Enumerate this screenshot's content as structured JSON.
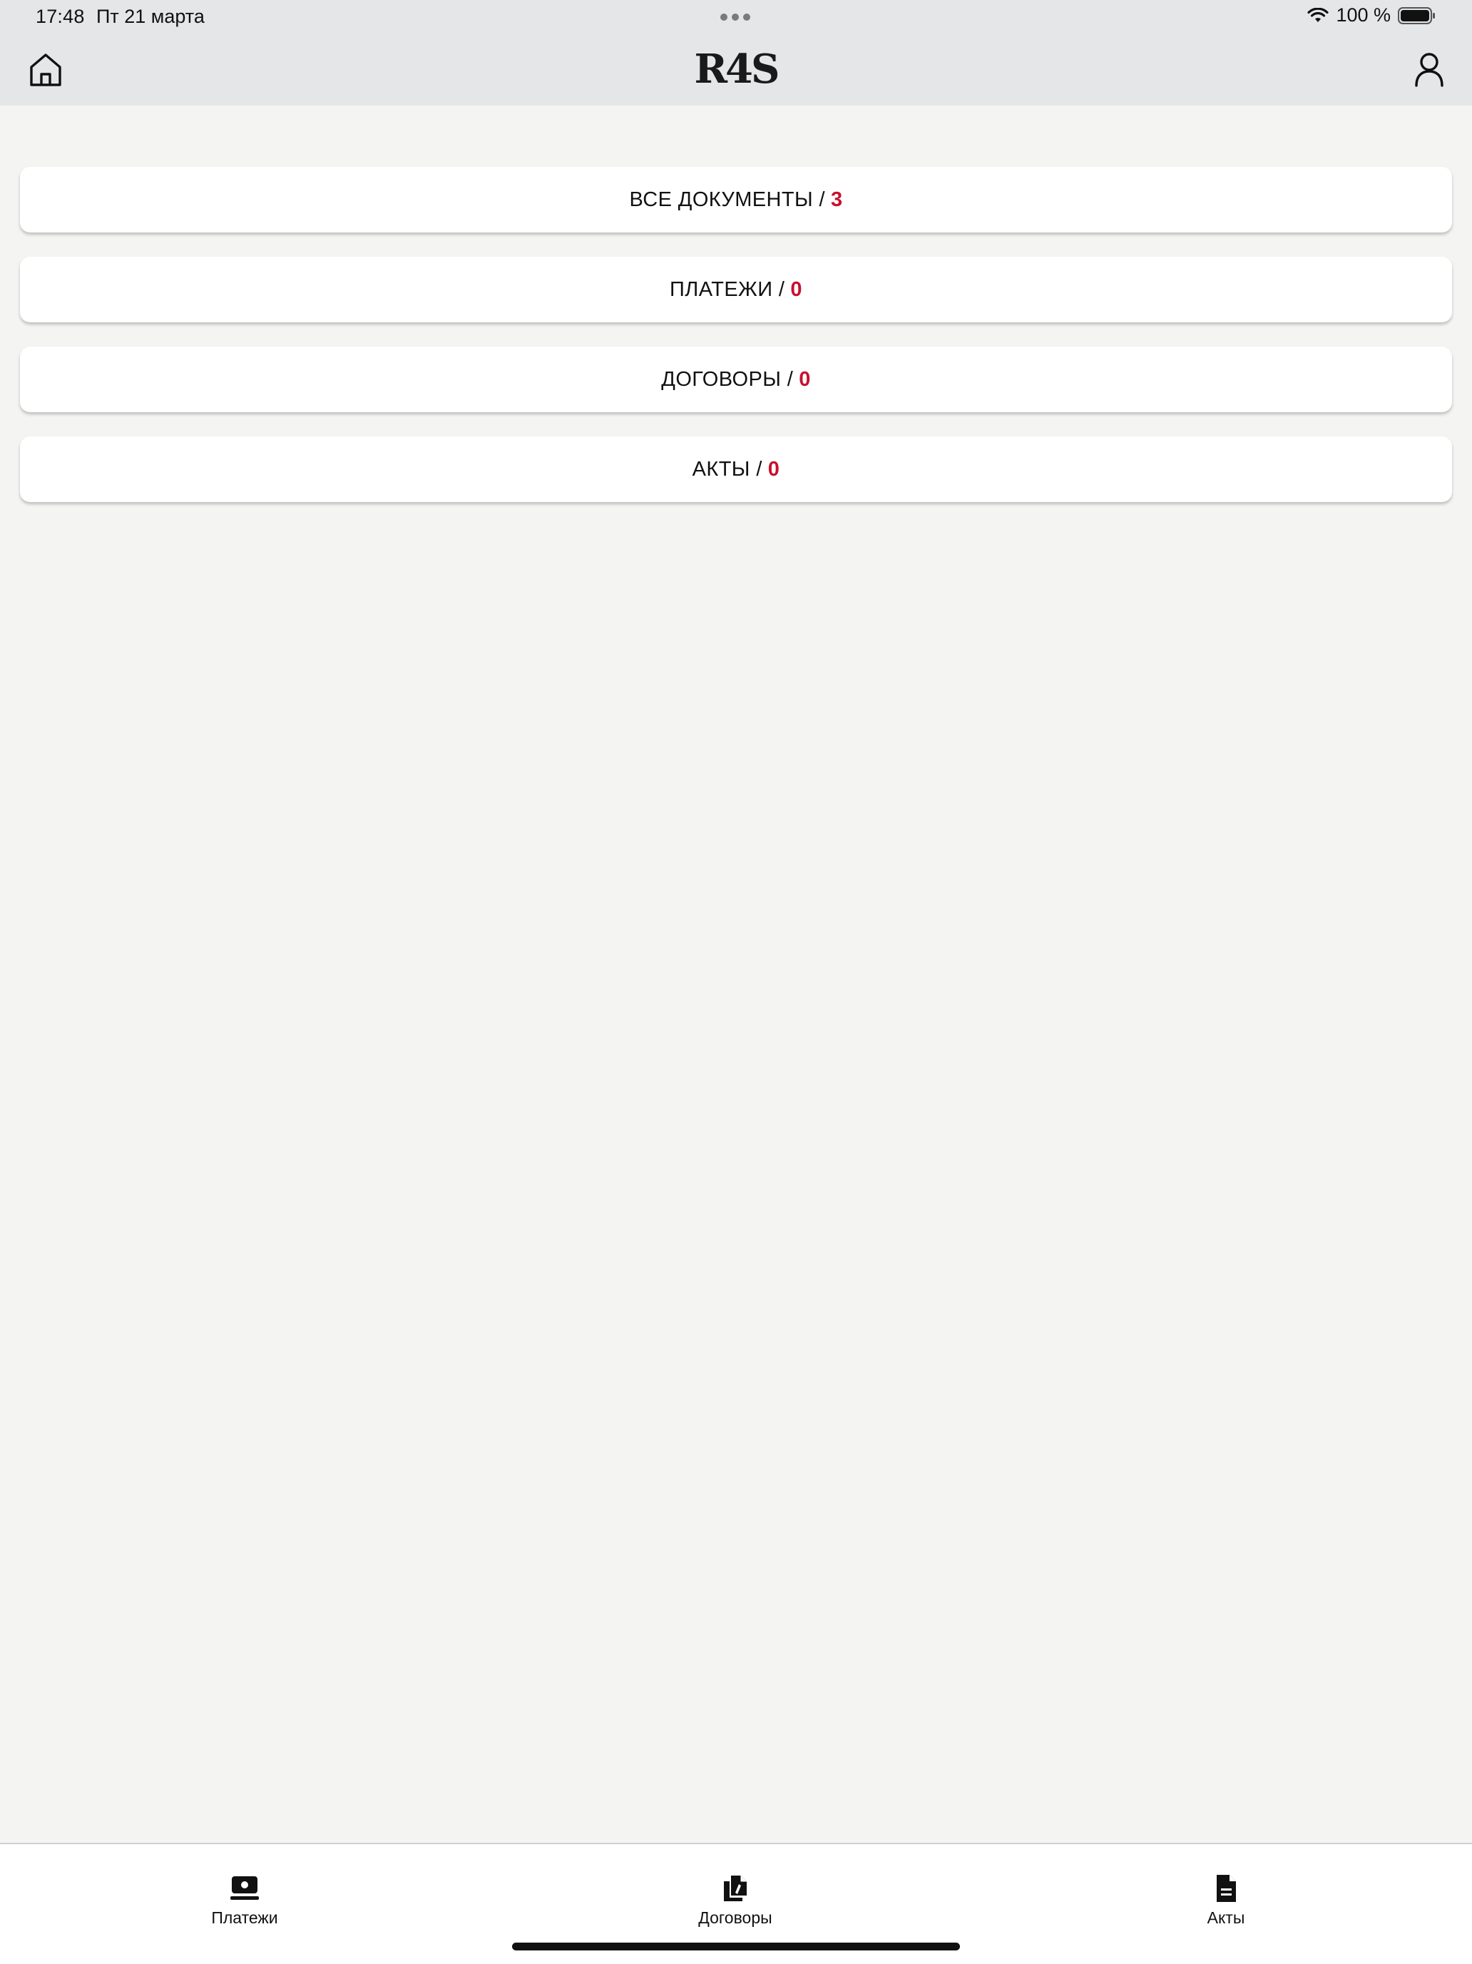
{
  "status_bar": {
    "time": "17:48",
    "date": "Пт 21 марта",
    "battery": "100 %"
  },
  "header": {
    "logo": "R4S",
    "home_icon": "home-icon",
    "profile_icon": "user-icon"
  },
  "documents": [
    {
      "label": "ВСЕ ДОКУМЕНТЫ /",
      "count": "3"
    },
    {
      "label": "ПЛАТЕЖИ /",
      "count": "0"
    },
    {
      "label": "ДОГОВОРЫ /",
      "count": "0"
    },
    {
      "label": "АКТЫ /",
      "count": "0"
    }
  ],
  "tabs": [
    {
      "label": "Платежи",
      "icon": "payment-icon"
    },
    {
      "label": "Договоры",
      "icon": "documents-icon"
    },
    {
      "label": "Акты",
      "icon": "document-icon"
    }
  ],
  "colors": {
    "accent": "#c8102e",
    "header_bg": "#e5e6e8",
    "page_bg": "#f4f4f2"
  }
}
